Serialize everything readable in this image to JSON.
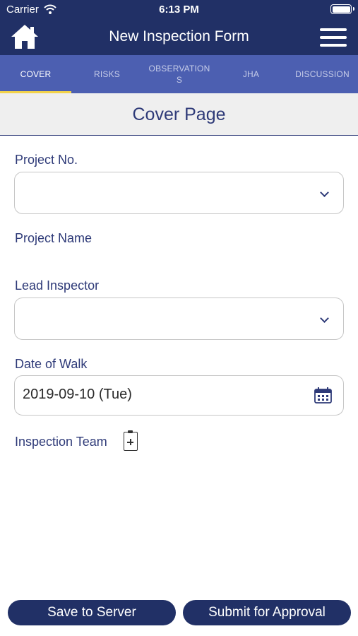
{
  "status_bar": {
    "carrier": "Carrier",
    "time": "6:13 PM"
  },
  "nav": {
    "title": "New Inspection Form"
  },
  "tabs": [
    {
      "label": "COVER",
      "active": true
    },
    {
      "label": "RISKS",
      "active": false
    },
    {
      "label": "OBSERVATION\nS",
      "active": false
    },
    {
      "label": "JHA",
      "active": false
    },
    {
      "label": "DISCUSSION",
      "active": false
    }
  ],
  "section": {
    "title": "Cover Page"
  },
  "form": {
    "project_no": {
      "label": "Project No.",
      "value": ""
    },
    "project_name": {
      "label": "Project Name"
    },
    "lead_inspector": {
      "label": "Lead Inspector",
      "value": ""
    },
    "date_of_walk": {
      "label": "Date of Walk",
      "value": "2019-09-10 (Tue)"
    },
    "inspection_team": {
      "label": "Inspection Team"
    }
  },
  "buttons": {
    "save": "Save to Server",
    "submit": "Submit for Approval"
  },
  "colors": {
    "nav": "#213066",
    "tabs": "#4c5fb1",
    "accent": "#f3d34a",
    "text": "#2e3a78"
  }
}
